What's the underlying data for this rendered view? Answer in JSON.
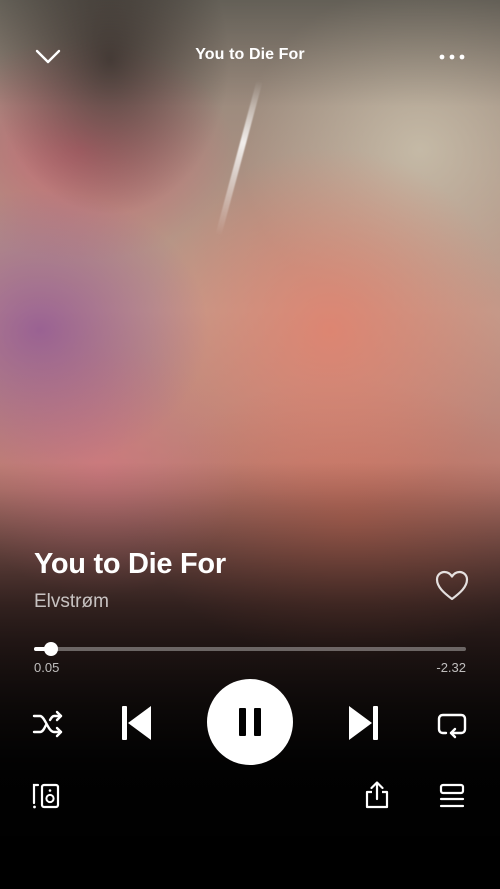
{
  "header": {
    "title": "You to Die For",
    "collapse_icon": "chevron-down-icon",
    "menu_icon": "more-horizontal-icon"
  },
  "track": {
    "title": "You to Die For",
    "artist": "Elvstrøm",
    "liked": false
  },
  "progress": {
    "elapsed": "0.05",
    "remaining": "-2.32",
    "fraction": 0.04
  },
  "controls": {
    "shuffle_icon": "shuffle-icon",
    "previous_icon": "skip-previous-icon",
    "play_state": "playing",
    "pause_icon": "pause-icon",
    "next_icon": "skip-next-icon",
    "repeat_icon": "repeat-icon"
  },
  "footer": {
    "devices_icon": "connect-device-icon",
    "share_icon": "share-icon",
    "queue_icon": "queue-icon"
  },
  "colors": {
    "accent": "#ffffff",
    "muted_text": "#b8b8b8"
  }
}
